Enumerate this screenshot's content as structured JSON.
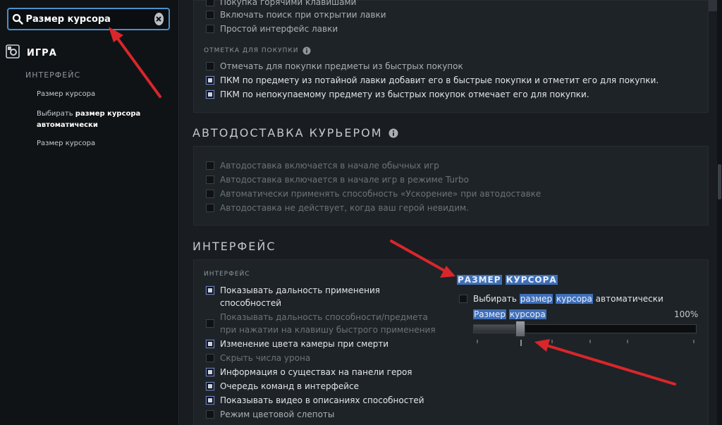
{
  "sidebar": {
    "search": {
      "value": "Размер курсора",
      "icon": "search-icon",
      "clear_icon": "clear-icon"
    },
    "category": {
      "label": "ИГРА",
      "icon": "gear-icon"
    },
    "subheader": "ИНТЕРФЕЙС",
    "results": [
      {
        "text": "Размер курсора"
      },
      {
        "prefix": "Выбирать ",
        "bold": "размер курсора",
        "suffix": "автоматически"
      },
      {
        "text": "Размер курсора"
      }
    ]
  },
  "shop": {
    "options_top": [
      {
        "label": "Покупка горячими клавишами",
        "checked": false
      },
      {
        "label": "Включать поиск при открытии лавки",
        "checked": false
      },
      {
        "label": "Простой интерфейс лавки",
        "checked": false
      }
    ],
    "purchase_mark_header": "ОТМЕТКА ДЛЯ ПОКУПКИ",
    "purchase_mark_options": [
      {
        "label": "Отмечать для покупки предметы из быстрых покупок",
        "checked": false
      },
      {
        "label": "ПКМ по предмету из потайной лавки добавит его в быстрые покупки и отметит его для покупки.",
        "checked": true
      },
      {
        "label": "ПКМ по непокупаемому предмету из быстрых покупок отмечает его для покупки.",
        "checked": true
      }
    ]
  },
  "courier": {
    "title": "АВТОДОСТАВКА КУРЬЕРОМ",
    "options": [
      {
        "label": "Автодоставка включается в начале обычных игр",
        "checked": false
      },
      {
        "label": "Автодоставка включается в начале игр в режиме Turbo",
        "checked": false
      },
      {
        "label": "Автоматически применять способность «Ускорение» при автодоставке",
        "checked": false
      },
      {
        "label": "Автодоставка не действует, когда ваш герой невидим.",
        "checked": false
      }
    ]
  },
  "interface": {
    "title": "ИНТЕРФЕЙС",
    "subheader": "ИНТЕРФЕЙС",
    "options": [
      {
        "line1": "Показывать дальность применения",
        "line2": "способностей",
        "checked": true
      },
      {
        "line1": "Показывать дальность способности/предмета",
        "line2": "при нажатии на клавишу быстрого применения",
        "checked": false
      },
      {
        "line1": "Изменение цвета камеры при смерти",
        "checked": true
      },
      {
        "line1": "Скрыть числа урона",
        "checked": false
      },
      {
        "line1": "Информация о существах на панели героя",
        "checked": true
      },
      {
        "line1": "Очередь команд в интерфейсе",
        "checked": true
      },
      {
        "line1": "Показывать видео в описаниях способностей",
        "checked": true
      },
      {
        "line1": "Режим цветовой слепоты",
        "checked": false
      }
    ],
    "cursor": {
      "title_word1": "РАЗМЕР",
      "title_word2": "КУРСОРА",
      "auto_prefix": "Выбирать ",
      "auto_hl1": "размер",
      "auto_hl2": "курсора",
      "auto_suffix": " автоматически",
      "auto_checked": false,
      "size_hl1": "Размер",
      "size_hl2": "курсора",
      "value": "100%",
      "slider_fraction": 0.2
    }
  },
  "colors": {
    "accent": "#4d8fc9",
    "highlight": "#3f6fb8",
    "arrow": "#d9262b"
  }
}
